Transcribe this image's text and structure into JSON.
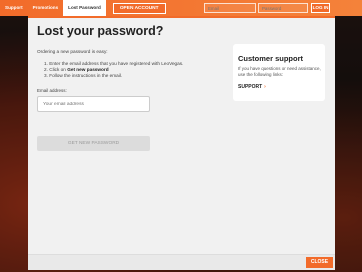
{
  "topbar": {
    "links": [
      "Support",
      "Promotions",
      "Lost Password"
    ],
    "open_account": "OPEN ACCOUNT",
    "email_placeholder": "Email",
    "password_placeholder": "Password",
    "login": "LOG IN"
  },
  "modal": {
    "title": "Lost your password?",
    "intro": "Ordering a new password is easy:",
    "steps": [
      "1. Enter the email address that you have registered with LeoVegas.",
      "2. Click on ",
      "Get new password",
      "3. Follow the instructions in the email."
    ],
    "email_label": "Email address:",
    "email_placeholder": "Your email address",
    "submit": "GET NEW PASSWORD",
    "support": {
      "title": "Customer support",
      "text": "If you have questions or need assistance, use the following links:",
      "link": "SUPPORT",
      "chevron": "›"
    },
    "close": "CLOSE"
  },
  "colors": {
    "accent": "#f26b2a",
    "modal_bg": "#f1f1f1"
  }
}
